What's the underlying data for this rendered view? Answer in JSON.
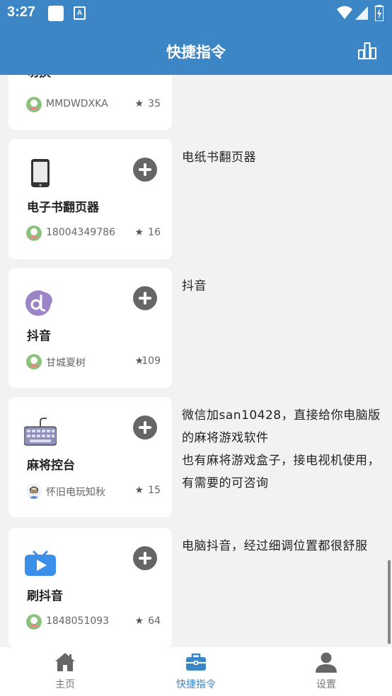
{
  "status_bar": {
    "time": "3:27",
    "notif_letter": "A"
  },
  "app_bar": {
    "title": "快捷指令"
  },
  "cards": [
    {
      "name": "切换",
      "author": "MMDWDXKA",
      "stars": "35",
      "description": ""
    },
    {
      "name": "电子书翻页器",
      "author": "18004349786",
      "stars": "16",
      "description": "电纸书翻页器",
      "icon": "phone-icon"
    },
    {
      "name": "抖音",
      "author": "甘城夏树",
      "stars": "109",
      "description": "抖音",
      "icon": "music-disc-icon"
    },
    {
      "name": "麻将控台",
      "author": "怀旧电玩知秋",
      "stars": "15",
      "description": "微信加san10428，直接给你电脑版的麻将游戏软件\n也有麻将游戏盒子，接电视机使用，有需要的可咨询",
      "icon": "keyboard-icon"
    },
    {
      "name": "刷抖音",
      "author": "1848051093",
      "stars": "64",
      "description": "电脑抖音，经过细调位置都很舒服",
      "icon": "tv-play-icon"
    }
  ],
  "bottom_nav": [
    {
      "label": "主页",
      "icon": "home-icon",
      "active": false
    },
    {
      "label": "快捷指令",
      "icon": "toolbox-icon",
      "active": true
    },
    {
      "label": "设置",
      "icon": "person-icon",
      "active": false
    }
  ],
  "colors": {
    "primary": "#3d86c6",
    "background": "#f2f2f2",
    "card": "#ffffff"
  }
}
